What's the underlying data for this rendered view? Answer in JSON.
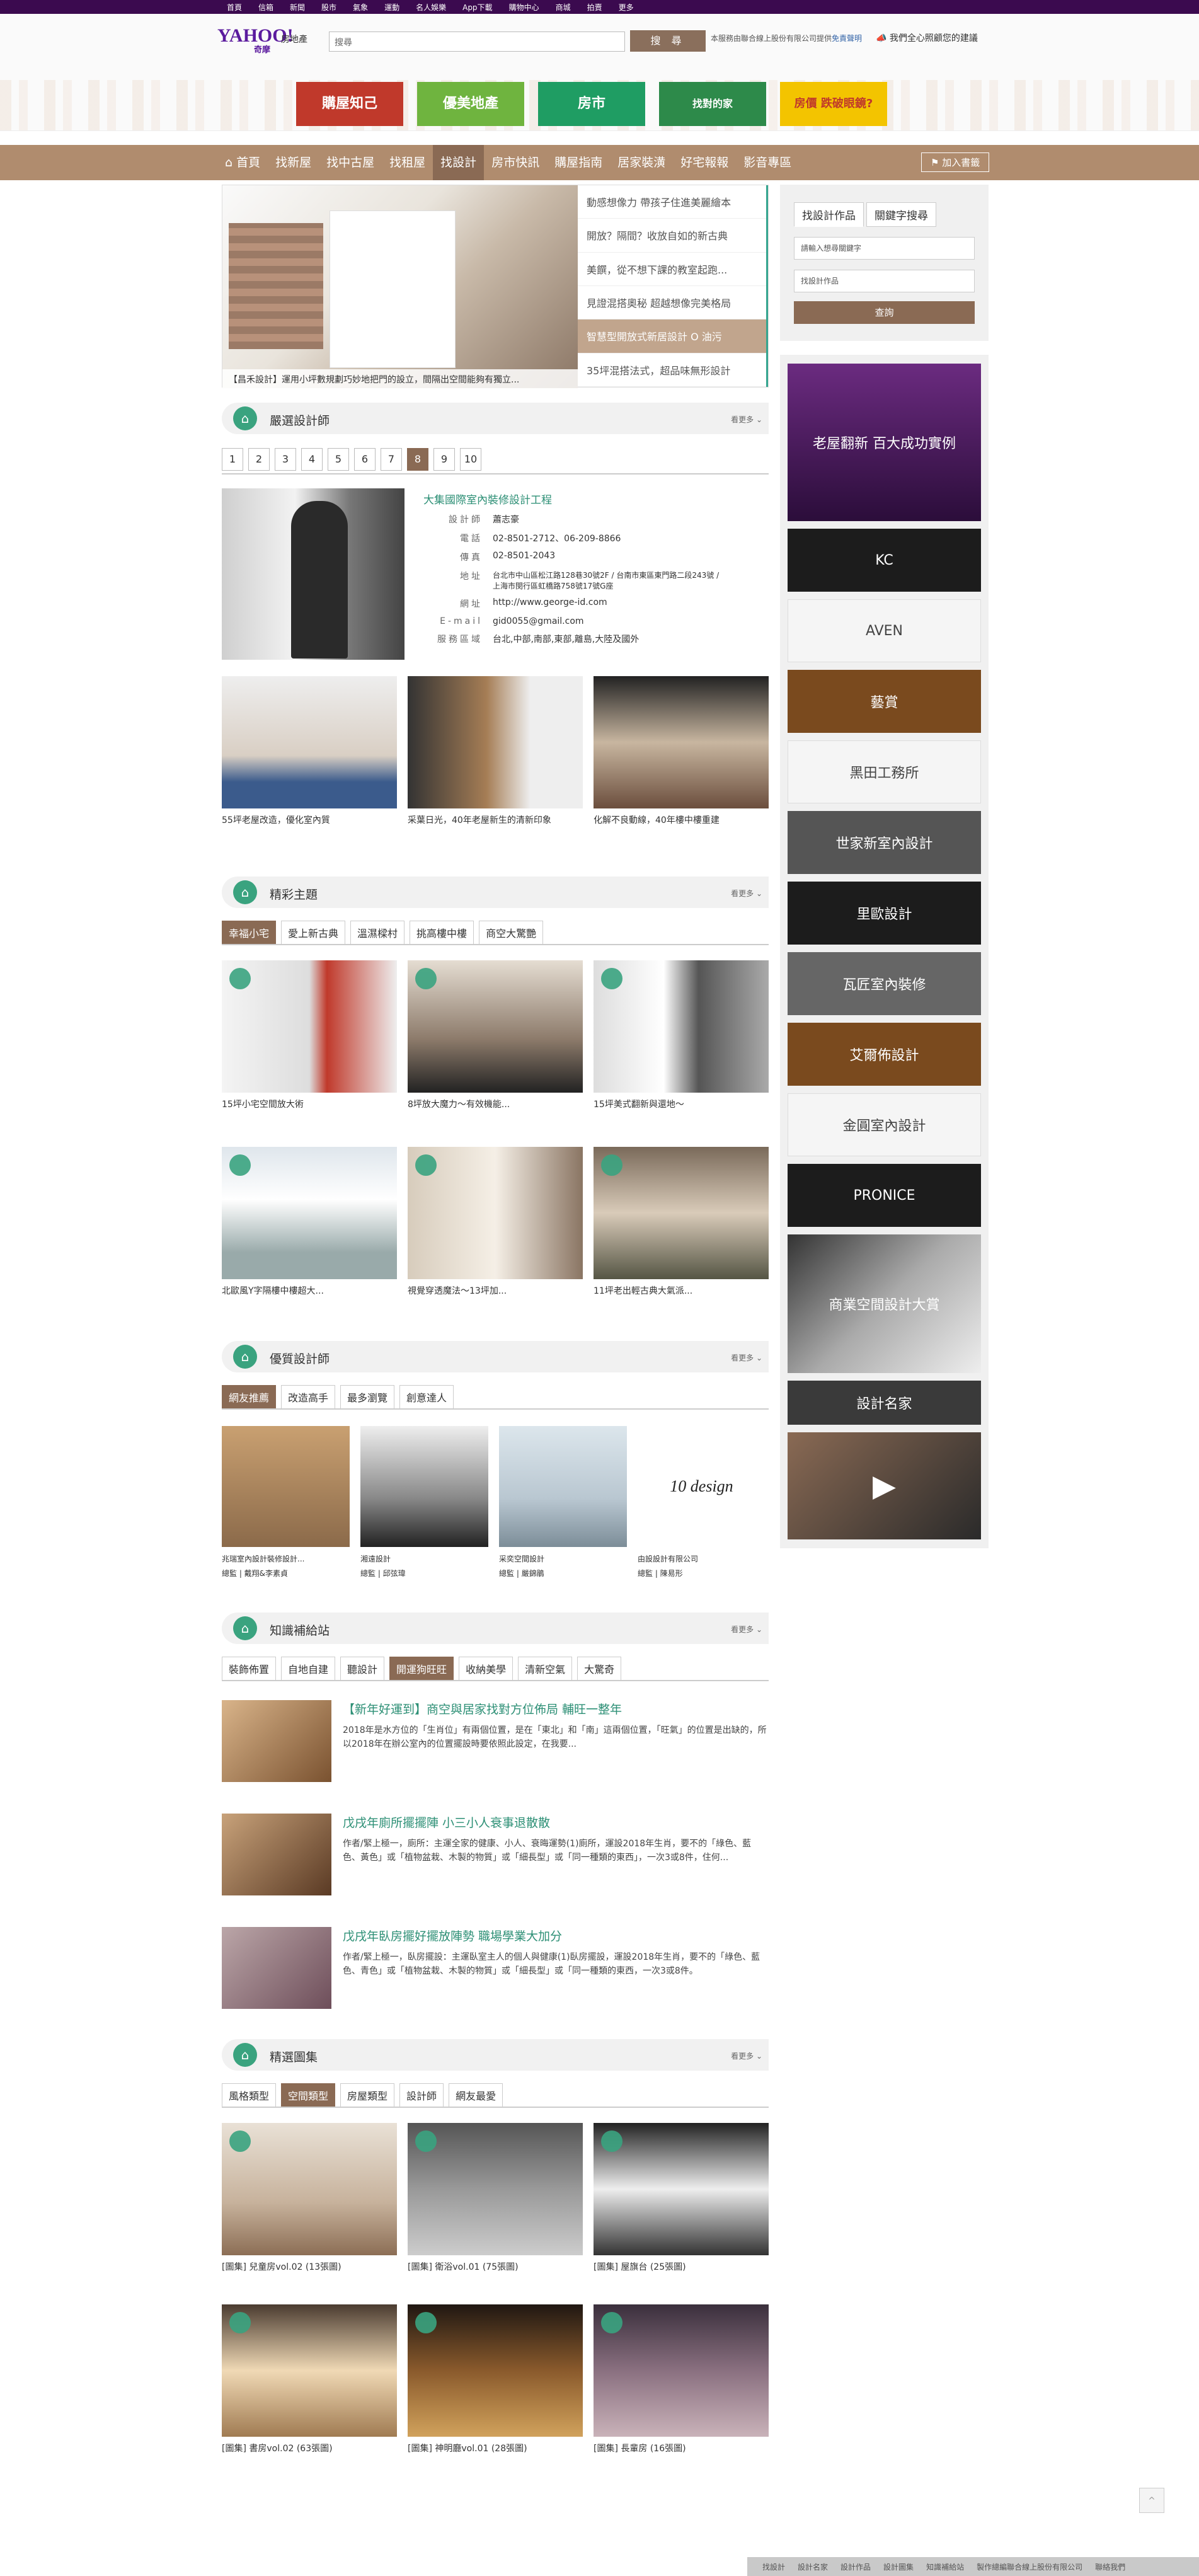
{
  "topbar": [
    "首頁",
    "信箱",
    "新聞",
    "股市",
    "氣象",
    "運動",
    "名人娛樂",
    "App下載",
    "購物中心",
    "商城",
    "拍賣",
    "更多"
  ],
  "header": {
    "logo": "YAHOO!",
    "logo_sub": "奇摩",
    "site": "房地產",
    "search_placeholder": "搜尋",
    "search_btn": "搜 尋",
    "note": "本服務由聯合線上股份有限公司提供",
    "note_link": "免責聲明",
    "report": "我們全心照顧您的建議"
  },
  "ads": [
    "購屋知己",
    "優美地產",
    "房市",
    "找對的家",
    "房價 跌破眼鏡?"
  ],
  "nav": {
    "items": [
      "首頁",
      "找新屋",
      "找中古屋",
      "找租屋",
      "找設計",
      "房市快訊",
      "購屋指南",
      "居家裝潢",
      "好宅報報",
      "影音專區"
    ],
    "fav": "加入書籤"
  },
  "hero": {
    "caption": "【昌禾設計】運用小坪數規劃巧妙地把門的設立，間隔出空間能夠有獨立...",
    "list": [
      "動感想像力 帶孩子住進美麗繪本",
      "開放？隔間？收放自如的新古典",
      "美饌，從不想下課的教室起跑...",
      "見證混搭奧秘 超越想像完美格局",
      "智慧型開放式新居設計 O 油污",
      "35坪混搭法式，超品味無形設計"
    ]
  },
  "sec1": {
    "title": "嚴選設計師",
    "more": "看更多 ⌄"
  },
  "pager": [
    "1",
    "2",
    "3",
    "4",
    "5",
    "6",
    "7",
    "8",
    "9",
    "10"
  ],
  "designer": {
    "name": "大集國際室內裝修設計工程",
    "rows": [
      [
        "設計師",
        "蕭志豪"
      ],
      [
        "電話",
        "02-8501-2712、06-209-8866"
      ],
      [
        "傳真",
        "02-8501-2043"
      ],
      [
        "地址",
        "台北市中山區松江路128巷30號2F / 台南市東區東門路二段243號 / 上海市閔行區虹橋路758號17號G座"
      ],
      [
        "網址",
        "http://www.george-id.com"
      ],
      [
        "E-mail",
        "gid0055@gmail.com"
      ],
      [
        "服務區域",
        "台北,中部,南部,東部,離島,大陸及國外"
      ]
    ]
  },
  "d_thumbs": [
    "55坪老屋改造，優化室內質",
    "采葉日光，40年老屋新生的清新印象",
    "化解不良動線，40年樓中樓重建"
  ],
  "sec2": {
    "title": "精彩主題",
    "more": "看更多 ⌄",
    "tabs": [
      "幸福小宅",
      "愛上新古典",
      "溫濕樑村",
      "挑高樓中樓",
      "商空大驚艷"
    ],
    "cards": [
      "15坪小宅空間放大術",
      "8坪放大魔力～有效機能...",
      "15坪美式翻新與還地～",
      "北歐風Y字隔樓中樓超大...",
      "視覺穿透魔法～13坪加...",
      "11坪老出輕古典大氣派..."
    ]
  },
  "sec3": {
    "title": "優質設計師",
    "more": "看更多 ⌄",
    "tabs": [
      "網友推薦",
      "改造高手",
      "最多瀏覽",
      "創意達人"
    ],
    "cards": [
      [
        "兆瑞室內設計裝修設計...",
        "總監 | 戴翔&李素貞"
      ],
      [
        "湘遠設計",
        "總監 | 邱弦瑋"
      ],
      [
        "采奕空間設計",
        "總監 | 嚴錦鵑"
      ],
      [
        "由設設計有限公司",
        "總監 | 陳易形"
      ]
    ],
    "logo_text": "10 design"
  },
  "sec4": {
    "title": "知識補給站",
    "more": "看更多 ⌄",
    "tabs": [
      "裝飾佈置",
      "自地自建",
      "聽設計",
      "開運狗旺旺",
      "收納美學",
      "清新空氣",
      "大驚奇"
    ],
    "articles": [
      {
        "t": "【新年好運到】商空與居家找對方位佈局 輔旺一整年",
        "p": "2018年是水方位的「生肖位」有兩個位置，是在「東北」和「南」這兩個位置，「旺氣」的位置是出缺的，所以2018年在辦公室內的位置擺設時要依照此設定，在我要..."
      },
      {
        "t": "戊戌年廁所擺擺陣 小三小人衰事退散散",
        "p": "作者/緊上極一，廁所：主運全家的健康、小人、衰晦運勢(1)廁所，運設2018年生肖，要不的「綠色、藍色、黃色」或「植物盆栽、木製的物質」或「細長型」或「同一種類的東西」，一次3或8件，住何..."
      },
      {
        "t": "戊戌年臥房擺好擺放陣勢 職場學業大加分",
        "p": "作者/緊上極一，臥房擺設：主運臥室主人的個人與健康(1)臥房擺設，運設2018年生肖，要不的「綠色、藍色、青色」或「植物盆栽、木製的物質」或「細長型」或「同一種類的東西，一次3或8件。"
      }
    ]
  },
  "sec5": {
    "title": "精選圖集",
    "more": "看更多 ⌄",
    "tabs": [
      "風格類型",
      "空間類型",
      "房屋類型",
      "設計師",
      "網友最愛"
    ],
    "cards": [
      "[圖集] 兒童房vol.02 (13張圖)",
      "[圖集] 衛浴vol.01 (75張圖)",
      "[圖集] 屋旗台 (25張圖)",
      "[圖集] 書房vol.02 (63張圖)",
      "[圖集] 神明廳vol.01 (28張圖)",
      "[圖集] 長輩房 (16張圖)"
    ]
  },
  "side": {
    "tabs": [
      "找設計作品",
      "關鍵字搜尋"
    ],
    "field1": "請輸入想尋關鍵字",
    "field2": "找設計作品",
    "btn": "查詢",
    "ads": [
      "老屋翻新 百大成功實例",
      "KC",
      "AVEN",
      "藝賞",
      "黑田工務所",
      "世家新室內設計",
      "里歐設計",
      "瓦匠室內裝修",
      "艾爾佈設計",
      "金圓室內設計",
      "PRONICE",
      "商業空間設計大賞",
      "設計名家",
      "▶"
    ]
  },
  "footer": [
    "找設計",
    "設計名家",
    "設計作品",
    "設計圖集",
    "知識補給站",
    "製作總編聯合線上股份有限公司",
    "聯絡我們"
  ],
  "colors": {
    "accent": "#3aa37f",
    "brand": "#8a6a54",
    "nav": "#b08c6e"
  }
}
